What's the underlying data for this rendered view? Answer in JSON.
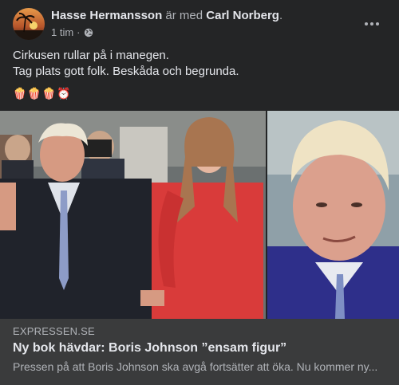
{
  "post": {
    "author": "Hasse Hermansson",
    "with_text": "är med",
    "tagged": "Carl Norberg",
    "period": ".",
    "time": "1 tim",
    "dot": "·",
    "text_line1": "Cirkusen rullar på i manegen.",
    "text_line2": "Tag plats gott folk. Beskåda och begrunda.",
    "emojis": "🍿🍿🍿⏰"
  },
  "icons": {
    "audience": "globe-icon",
    "menu": "more-options-icon",
    "avatar": "profile-avatar"
  },
  "link": {
    "domain": "EXPRESSEN.SE",
    "title": "Ny bok hävdar: Boris Johnson ”ensam figur”",
    "description": "Pressen på att Boris Johnson ska avgå fortsätter att öka. Nu kommer ny..."
  },
  "colors": {
    "card_bg": "#242526",
    "link_bg": "#3a3b3c",
    "text_primary": "#e4e6eb",
    "text_secondary": "#b0b3b8"
  }
}
